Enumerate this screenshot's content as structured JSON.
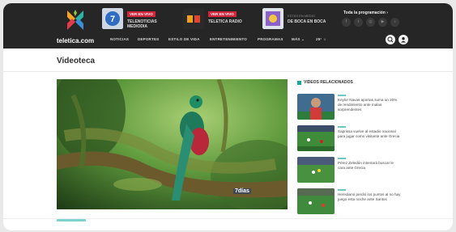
{
  "header": {
    "logo_text": "teletica.com",
    "live": [
      {
        "badge": "VER EN VIVO",
        "title": "TELENOTICIAS MEDIODIA",
        "icon": "channel-7-icon"
      },
      {
        "badge": "VER EN VIVO",
        "title": "TELETICA RADIO",
        "icon": "radio-icon"
      },
      {
        "small": "ESTÁS EN MEDIO",
        "title": "DE BOCA EN BOCA",
        "icon": "show-thumbnail-icon"
      }
    ],
    "programming_link": "Toda la programación ›",
    "social_icons": [
      "facebook-icon",
      "twitter-icon",
      "instagram-icon",
      "youtube-icon",
      "tiktok-icon"
    ],
    "nav": [
      "NOTICIAS",
      "DEPORTES",
      "ESTILO DE VIDA",
      "ENTRETENIMIENTO",
      "PROGRAMAS",
      "MÁS ⌄",
      "25° ☼"
    ],
    "buttons": [
      "search-icon",
      "user-icon"
    ]
  },
  "page": {
    "title": "Videoteca"
  },
  "video": {
    "watermark": "7días"
  },
  "related": {
    "heading": "VIDEOS RELACIONADOS",
    "items": [
      {
        "text": "Keylor Navas aportas suma un 20% de rendimiento ante malas sorprendentes"
      },
      {
        "text": "Saprissa vuelve al estadio nacional para jugar como visitante ante Grecia"
      },
      {
        "text": "Pérez Zeledón intentará buscar le cara ante Grecia"
      },
      {
        "text": "Herediano perdió los puntos al no hay juego esta noche ante Santos"
      }
    ]
  },
  "colors": {
    "header_bg": "#262626",
    "live_badge": "#d6243b",
    "accent_teal": "#17a7a0"
  }
}
